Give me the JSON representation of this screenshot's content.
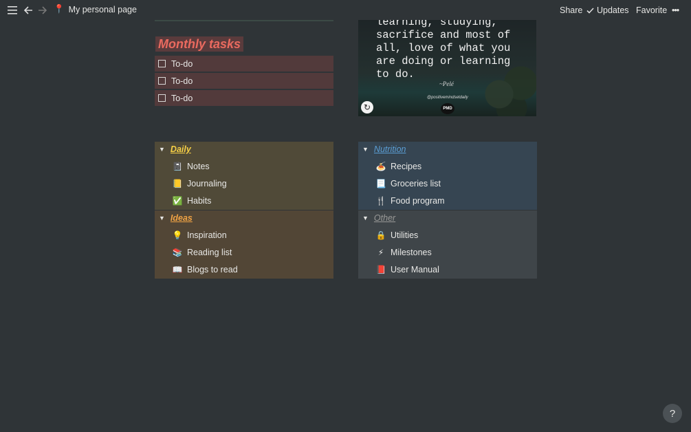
{
  "topbar": {
    "page_icon": "📍",
    "page_title": "My personal page",
    "share_label": "Share",
    "updates_label": "Updates",
    "favorite_label": "Favorite",
    "more_label": "•••"
  },
  "monthly": {
    "title": "Monthly tasks",
    "todos": [
      {
        "label": "To-do",
        "checked": false
      },
      {
        "label": "To-do",
        "checked": false
      },
      {
        "label": "To-do",
        "checked": false
      }
    ]
  },
  "quote": {
    "text": "learning, studying,\nsacrifice and most of\nall, love of what you\nare doing or learning\nto do.",
    "author": "~Pelé",
    "handle": "@positivemindsetdaily",
    "logo": "PMD"
  },
  "sections": {
    "daily": {
      "title": "Daily",
      "color": "#f7d046",
      "bg": "#504a38",
      "items": [
        {
          "icon": "📓",
          "label": "Notes"
        },
        {
          "icon": "📒",
          "label": "Journaling"
        },
        {
          "icon": "✅",
          "label": "Habits"
        }
      ]
    },
    "ideas": {
      "title": "Ideas",
      "color": "#f0a344",
      "bg": "#524636",
      "items": [
        {
          "icon": "💡",
          "label": "Inspiration"
        },
        {
          "icon": "📚",
          "label": "Reading list"
        },
        {
          "icon": "📖",
          "label": "Blogs to read"
        }
      ]
    },
    "nutrition": {
      "title": "Nutrition",
      "color": "#5b9fd6",
      "bg": "#364552",
      "items": [
        {
          "icon": "🍝",
          "label": "Recipes"
        },
        {
          "icon": "📃",
          "label": "Groceries list"
        },
        {
          "icon": "🍴",
          "label": "Food program"
        }
      ]
    },
    "other": {
      "title": "Other",
      "color": "#9a9a98",
      "bg": "#3f4549",
      "items": [
        {
          "icon": "🔒",
          "label": "Utilities"
        },
        {
          "icon": "⚡",
          "label": "Milestones"
        },
        {
          "icon": "📕",
          "label": "User Manual"
        }
      ]
    }
  },
  "help": {
    "label": "?"
  }
}
